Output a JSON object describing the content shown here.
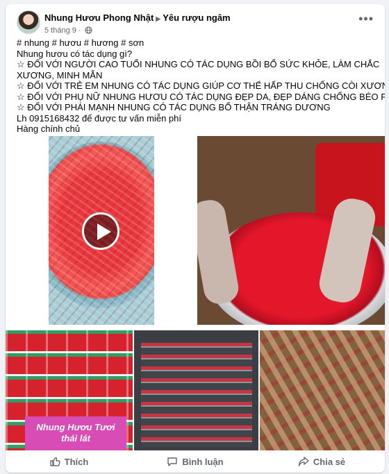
{
  "post": {
    "author": "Nhung Hươu Phong Nhật",
    "group": "Yêu rượu ngâm",
    "date": "5 tháng 9",
    "more": "•••",
    "lines": [
      "# nhung # hươu # hương # sơn",
      "Nhung hươu có tác dụng gì?",
      "☆ ĐỐI VỚI NGƯỜI CAO TUỔI NHUNG CÓ TÁC DỤNG BỒI BỔ SỨC KHỎE, LÀM CHẮC",
      "XƯƠNG, MINH MẪN",
      "☆ ĐỐI VỚI TRẺ EM NHUNG CÓ TÁC DỤNG GIÚP CƠ THỂ HẤP THU CHỐNG CÒI XƯƠNG",
      "☆ ĐỐI VỚI PHỤ NỮ NHUNG HƯƠU CÓ TÁC DỤNG ĐẸP DA, ĐẸP DÁNG CHỐNG BÉO PHÌ",
      "☆ ĐỐI VỚI PHÁI MẠNH NHUNG CÓ TÁC DỤNG BỔ THẬN TRÁNG DƯƠNG",
      "Lh 0915168432 để được tư vấn miễn phí",
      "Hàng chính chủ"
    ]
  },
  "media": {
    "badge_line1": "Nhung Hươu Tươi",
    "badge_line2": "thái lát"
  },
  "actions": {
    "like": "Thích",
    "comment": "Bình luận",
    "share": "Chia sẻ"
  }
}
